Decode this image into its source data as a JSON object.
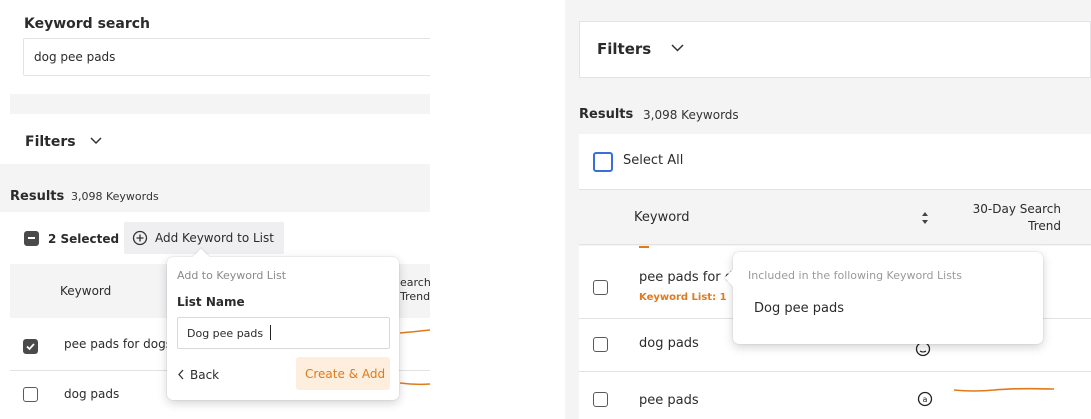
{
  "accent": "#e07a1a",
  "left": {
    "search": {
      "label": "Keyword search",
      "value": "dog pee pads"
    },
    "filters_label": "Filters",
    "results_label": "Results",
    "results_count": "3,098 Keywords",
    "selected_text": "2 Selected",
    "add_button": "Add Keyword to List",
    "col_keyword": "Keyword",
    "col_trend_partial": [
      "earch",
      "Trend"
    ],
    "rows": [
      {
        "keyword": "pee pads for dogs",
        "checked": true
      },
      {
        "keyword": "dog pads",
        "checked": false
      }
    ],
    "popover": {
      "title": "Add to Keyword List",
      "field_label": "List Name",
      "field_value": "Dog pee pads",
      "back": "Back",
      "create": "Create & Add"
    }
  },
  "right": {
    "filters_label": "Filters",
    "results_label": "Results",
    "results_count": "3,098 Keywords",
    "select_all": "Select All",
    "col_keyword": "Keyword",
    "col_trend": [
      "30-Day Search",
      "Trend"
    ],
    "rows": [
      {
        "keyword": "pee pads for d",
        "list_tag": "Keyword List: 1"
      },
      {
        "keyword": "dog pads"
      },
      {
        "keyword": "pee pads"
      }
    ],
    "popover": {
      "title": "Included in the following Keyword Lists",
      "item": "Dog pee pads"
    }
  },
  "icons": {
    "chevron": "chevron-down-icon",
    "plus_circle": "plus-circle-icon",
    "sort": "sort-icon",
    "back": "chevron-left-icon",
    "amazon": "amazon-icon"
  }
}
